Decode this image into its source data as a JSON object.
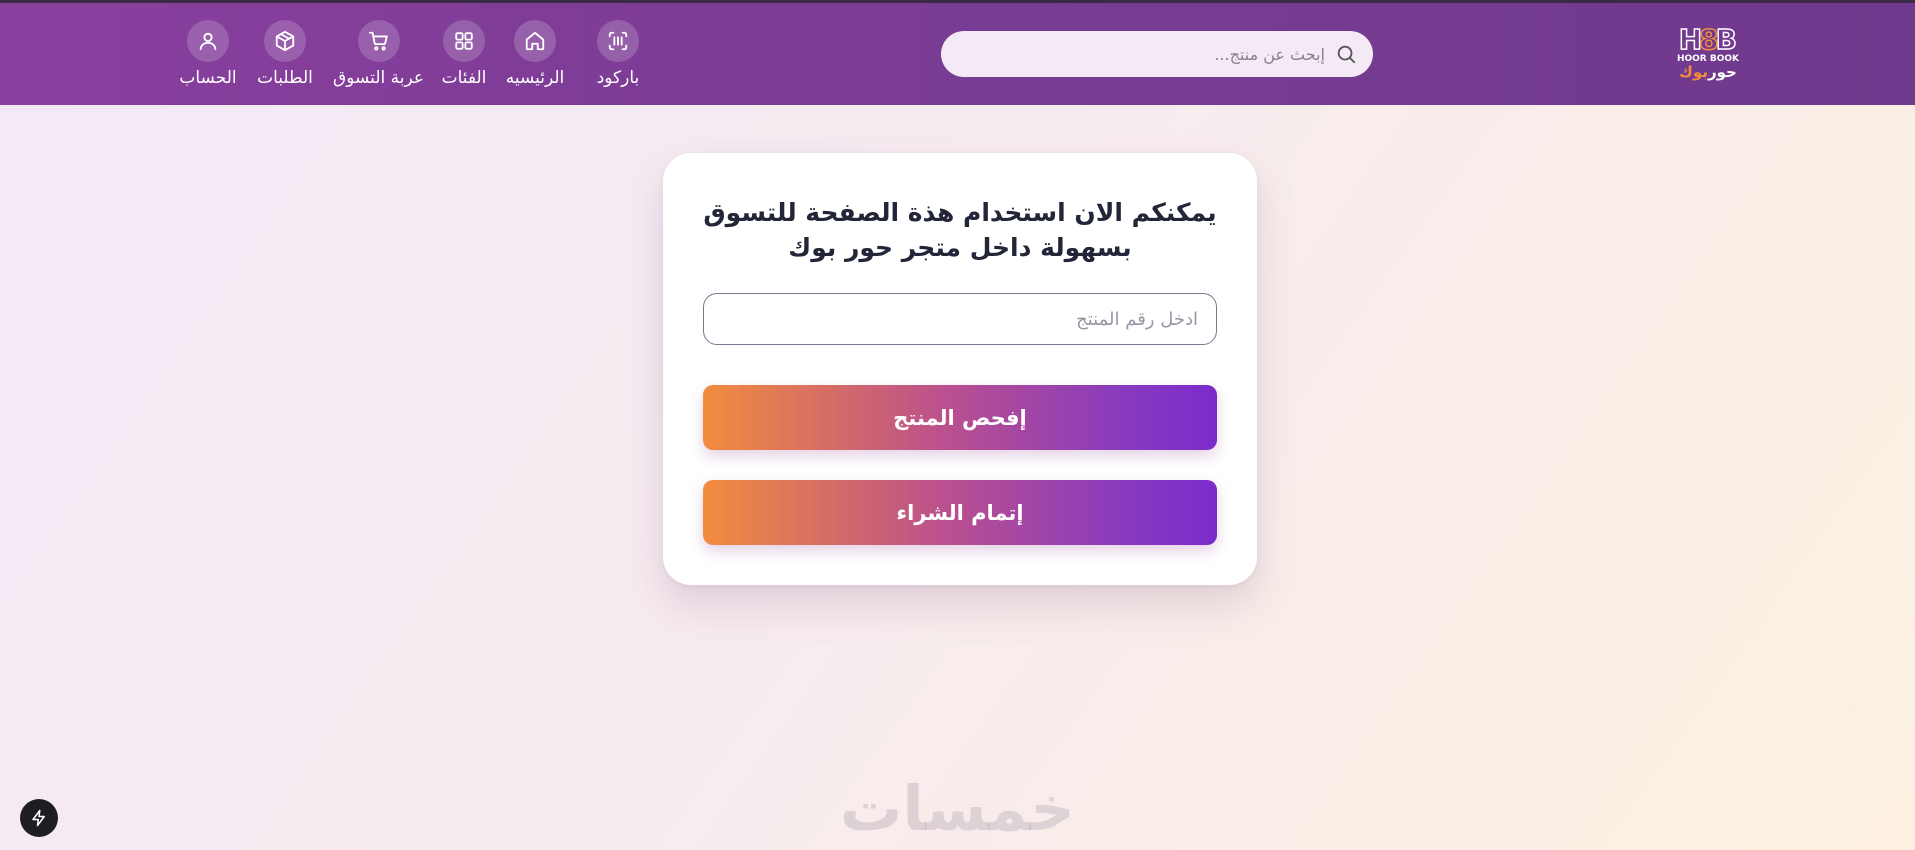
{
  "header": {
    "logo": {
      "mark": "H8B",
      "subtitle": "HOOR BOOK",
      "arabic_main": "حور",
      "arabic_accent": "بوك"
    },
    "search": {
      "placeholder": "إبحث عن منتج...",
      "value": "",
      "icon": "search-icon"
    },
    "nav": [
      {
        "label": "باركود",
        "icon": "barcode-icon"
      },
      {
        "label": "الرئيسيه",
        "icon": "home-icon"
      },
      {
        "label": "الفئات",
        "icon": "grid-icon"
      },
      {
        "label": "عربة التسوق",
        "icon": "cart-icon"
      },
      {
        "label": "الطلبات",
        "icon": "package-icon"
      },
      {
        "label": "الحساب",
        "icon": "user-icon"
      }
    ]
  },
  "main": {
    "title": "يمكنكم الان استخدام هذة الصفحة للتسوق بسهولة داخل متجر حور بوك",
    "product_input": {
      "placeholder": "ادخل رقم المنتج",
      "value": ""
    },
    "check_button": "إفحص المنتج",
    "checkout_button": "إتمام الشراء"
  },
  "footer": {
    "watermark": "خمسات",
    "quick_action_icon": "bolt-icon"
  },
  "colors": {
    "navbar": "#7b3c95",
    "gradient_start": "#7a2bcc",
    "gradient_end": "#f28c3d",
    "logo_accent": "#f28c3d",
    "title_text": "#232638"
  }
}
